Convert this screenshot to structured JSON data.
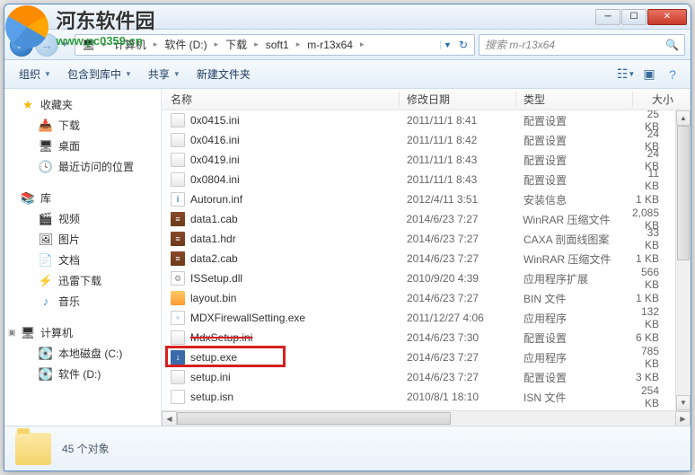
{
  "watermark": {
    "title": "河东软件园",
    "url": "www.pc0359.cn"
  },
  "breadcrumb": {
    "segments": [
      "计算机",
      "软件 (D:)",
      "下载",
      "soft1",
      "m-r13x64"
    ]
  },
  "search": {
    "placeholder": "搜索 m-r13x64"
  },
  "toolbar": {
    "organize": "组织",
    "include": "包含到库中",
    "share": "共享",
    "newfolder": "新建文件夹"
  },
  "sidebar": {
    "favorites": {
      "label": "收藏夹",
      "items": [
        "下载",
        "桌面",
        "最近访问的位置"
      ]
    },
    "libraries": {
      "label": "库",
      "items": [
        "视频",
        "图片",
        "文档",
        "迅雷下载",
        "音乐"
      ]
    },
    "computer": {
      "label": "计算机",
      "items": [
        "本地磁盘 (C:)",
        "软件 (D:)"
      ]
    }
  },
  "columns": {
    "name": "名称",
    "date": "修改日期",
    "type": "类型",
    "size": "大小"
  },
  "files": [
    {
      "icon": "ini",
      "name": "0x0415.ini",
      "date": "2011/11/1 8:41",
      "type": "配置设置",
      "size": "25 KB"
    },
    {
      "icon": "ini",
      "name": "0x0416.ini",
      "date": "2011/11/1 8:42",
      "type": "配置设置",
      "size": "24 KB"
    },
    {
      "icon": "ini",
      "name": "0x0419.ini",
      "date": "2011/11/1 8:43",
      "type": "配置设置",
      "size": "24 KB"
    },
    {
      "icon": "ini",
      "name": "0x0804.ini",
      "date": "2011/11/1 8:43",
      "type": "配置设置",
      "size": "11 KB"
    },
    {
      "icon": "inf",
      "name": "Autorun.inf",
      "date": "2012/4/11 3:51",
      "type": "安装信息",
      "size": "1 KB"
    },
    {
      "icon": "rar",
      "name": "data1.cab",
      "date": "2014/6/23 7:27",
      "type": "WinRAR 压缩文件",
      "size": "2,085 KB"
    },
    {
      "icon": "rar",
      "name": "data1.hdr",
      "date": "2014/6/23 7:27",
      "type": "CAXA 剖面线图案",
      "size": "33 KB"
    },
    {
      "icon": "rar",
      "name": "data2.cab",
      "date": "2014/6/23 7:27",
      "type": "WinRAR 压缩文件",
      "size": "1 KB"
    },
    {
      "icon": "dll",
      "name": "ISSetup.dll",
      "date": "2010/9/20 4:39",
      "type": "应用程序扩展",
      "size": "566 KB"
    },
    {
      "icon": "bin",
      "name": "layout.bin",
      "date": "2014/6/23 7:27",
      "type": "BIN 文件",
      "size": "1 KB"
    },
    {
      "icon": "exe",
      "name": "MDXFirewallSetting.exe",
      "date": "2011/12/27 4:06",
      "type": "应用程序",
      "size": "132 KB"
    },
    {
      "icon": "ini",
      "name": "MdxSetup.ini",
      "date": "2014/6/23 7:30",
      "type": "配置设置",
      "size": "6 KB",
      "struck": true
    },
    {
      "icon": "setup",
      "name": "setup.exe",
      "date": "2014/6/23 7:27",
      "type": "应用程序",
      "size": "785 KB",
      "highlight": true
    },
    {
      "icon": "ini",
      "name": "setup.ini",
      "date": "2014/6/23 7:27",
      "type": "配置设置",
      "size": "3 KB"
    },
    {
      "icon": "isn",
      "name": "setup.isn",
      "date": "2010/8/1 18:10",
      "type": "ISN 文件",
      "size": "254 KB"
    }
  ],
  "status": {
    "count": "45 个对象"
  }
}
